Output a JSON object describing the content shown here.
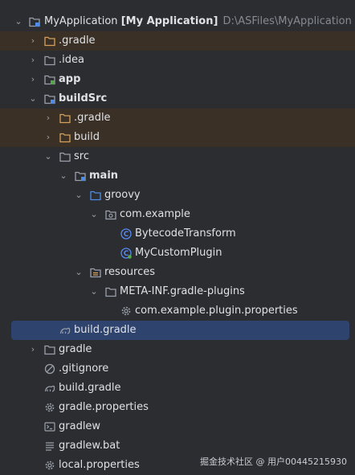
{
  "tree": {
    "root": {
      "label": "MyApplication",
      "module": "[My Application]",
      "path": "D:\\ASFiles\\MyApplication"
    },
    "items": [
      {
        "label": ".gradle",
        "icon": "folder-excluded"
      },
      {
        "label": ".idea",
        "icon": "folder"
      },
      {
        "label": "app",
        "icon": "module-folder"
      },
      {
        "label": "buildSrc",
        "icon": "module-folder"
      },
      {
        "label": ".gradle",
        "icon": "folder-excluded"
      },
      {
        "label": "build",
        "icon": "folder-excluded"
      },
      {
        "label": "src",
        "icon": "folder"
      },
      {
        "label": "main",
        "icon": "module-folder"
      },
      {
        "label": "groovy",
        "icon": "source-folder"
      },
      {
        "label": "com.example",
        "icon": "package"
      },
      {
        "label": "BytecodeTransform",
        "icon": "class"
      },
      {
        "label": "MyCustomPlugin",
        "icon": "class"
      },
      {
        "label": "resources",
        "icon": "resources-folder"
      },
      {
        "label": "META-INF.gradle-plugins",
        "icon": "folder"
      },
      {
        "label": "com.example.plugin.properties",
        "icon": "properties-file"
      },
      {
        "label": "build.gradle",
        "icon": "gradle-file"
      },
      {
        "label": "gradle",
        "icon": "folder"
      },
      {
        "label": ".gitignore",
        "icon": "gitignore-file"
      },
      {
        "label": "build.gradle",
        "icon": "gradle-file"
      },
      {
        "label": "gradle.properties",
        "icon": "properties-file"
      },
      {
        "label": "gradlew",
        "icon": "terminal-file"
      },
      {
        "label": "gradlew.bat",
        "icon": "text-file"
      },
      {
        "label": "local.properties",
        "icon": "properties-file"
      }
    ]
  },
  "watermark": "掘金技术社区 @ 用户00445215930",
  "colors": {
    "background": "#2b2d30",
    "selection": "#2e436e",
    "excluded_row": "#3a3025",
    "folder": "#9aa0ab",
    "folder_excluded": "#d5a15b",
    "source_folder": "#4d8de8",
    "class_icon": "#548af7"
  }
}
